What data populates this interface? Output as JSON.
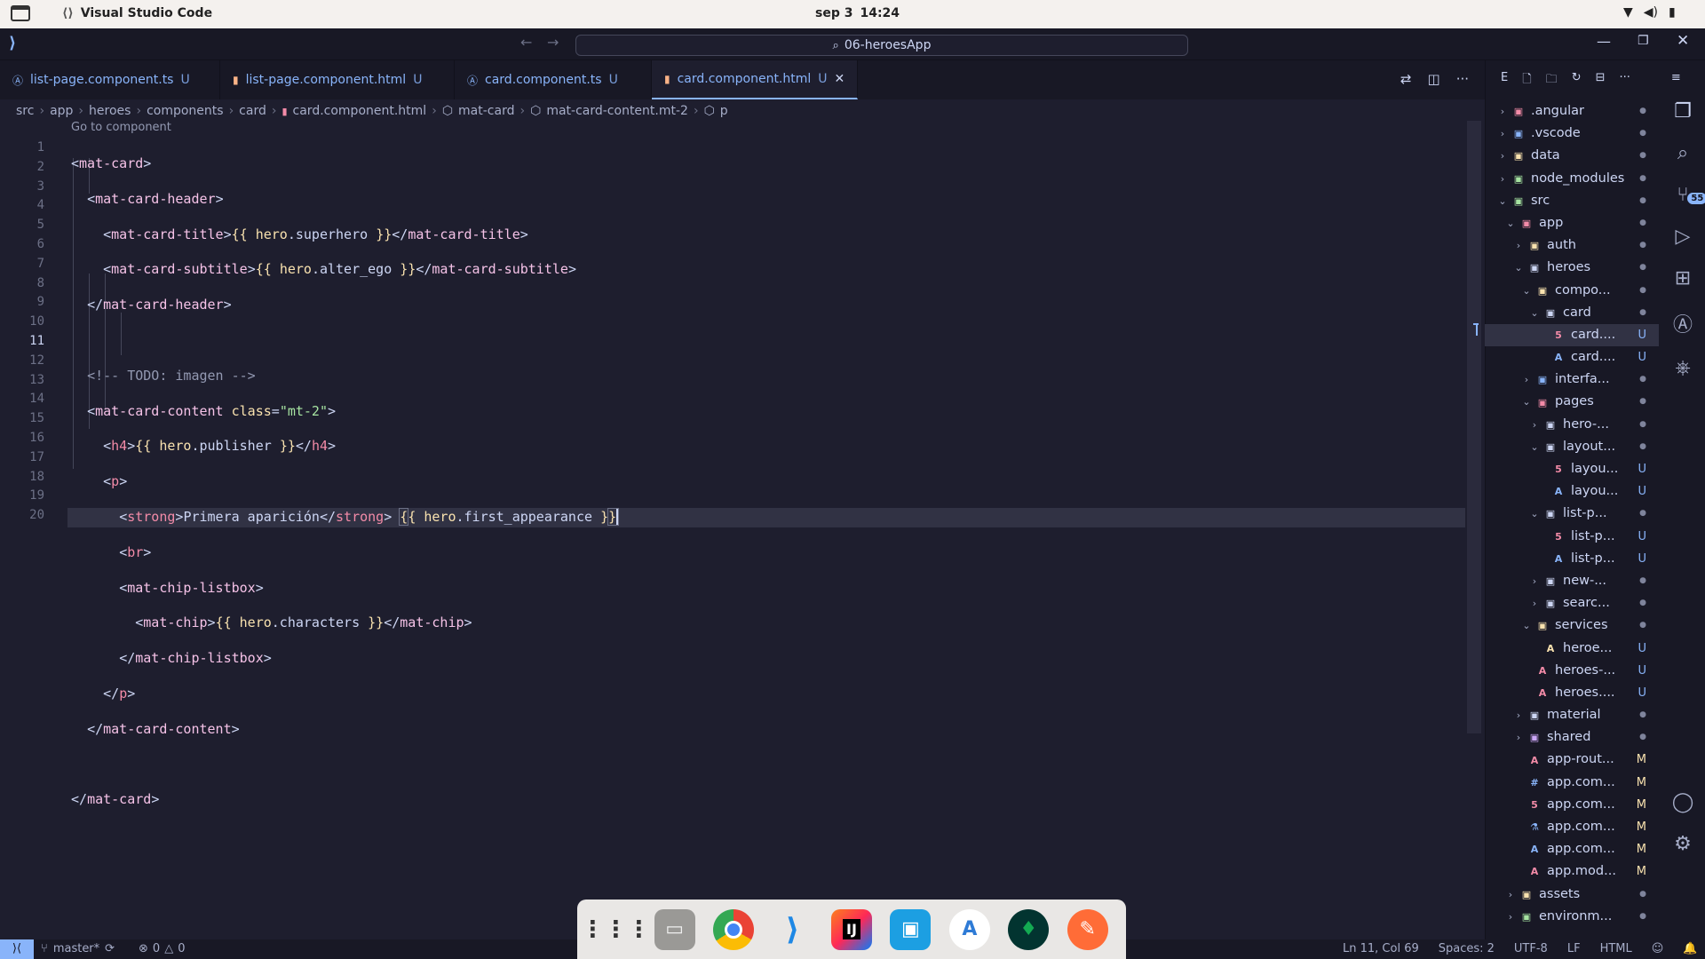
{
  "system_bar": {
    "app_name": "Visual Studio Code",
    "date": "sep 3",
    "time": "14:24"
  },
  "titlebar": {
    "search_text": "06-heroesApp"
  },
  "tabs": [
    {
      "label": "list-page.component.ts",
      "status": "U",
      "icon": "angular-ts-icon",
      "active": false
    },
    {
      "label": "list-page.component.html",
      "status": "U",
      "icon": "html-icon",
      "active": false
    },
    {
      "label": "card.component.ts",
      "status": "U",
      "icon": "angular-ts-icon",
      "active": false
    },
    {
      "label": "card.component.html",
      "status": "U",
      "icon": "html-icon",
      "active": true
    }
  ],
  "breadcrumb": {
    "items": [
      "src",
      "app",
      "heroes",
      "components",
      "card",
      "card.component.html",
      "mat-card",
      "mat-card-content.mt-2",
      "p"
    ]
  },
  "editor": {
    "codelens": "Go to component",
    "current_line": 11,
    "line_numbers": [
      "1",
      "2",
      "3",
      "4",
      "5",
      "6",
      "7",
      "8",
      "9",
      "10",
      "11",
      "12",
      "13",
      "14",
      "15",
      "16",
      "17",
      "18",
      "19",
      "20"
    ]
  },
  "explorer": {
    "header_letter": "E",
    "items": [
      {
        "label": ".angular",
        "badge": "",
        "dot": true
      },
      {
        "label": ".vscode",
        "badge": "",
        "dot": true
      },
      {
        "label": "data",
        "badge": "",
        "dot": true
      },
      {
        "label": "node_modules",
        "badge": "",
        "dot": true
      },
      {
        "label": "src",
        "badge": "",
        "dot": true
      },
      {
        "label": "app",
        "badge": "",
        "dot": true
      },
      {
        "label": "auth",
        "badge": "",
        "dot": true
      },
      {
        "label": "heroes",
        "badge": "",
        "dot": true
      },
      {
        "label": "compo...",
        "badge": "",
        "dot": true
      },
      {
        "label": "card",
        "badge": "",
        "dot": true
      },
      {
        "label": "card....",
        "badge": "U",
        "dot": false
      },
      {
        "label": "card....",
        "badge": "U",
        "dot": false
      },
      {
        "label": "interfa...",
        "badge": "",
        "dot": true
      },
      {
        "label": "pages",
        "badge": "",
        "dot": true
      },
      {
        "label": "hero-...",
        "badge": "",
        "dot": true
      },
      {
        "label": "layout...",
        "badge": "",
        "dot": true
      },
      {
        "label": "layou...",
        "badge": "U",
        "dot": false
      },
      {
        "label": "layou...",
        "badge": "U",
        "dot": false
      },
      {
        "label": "list-p...",
        "badge": "",
        "dot": true
      },
      {
        "label": "list-p...",
        "badge": "U",
        "dot": false
      },
      {
        "label": "list-p...",
        "badge": "U",
        "dot": false
      },
      {
        "label": "new-...",
        "badge": "",
        "dot": true
      },
      {
        "label": "searc...",
        "badge": "",
        "dot": true
      },
      {
        "label": "services",
        "badge": "",
        "dot": true
      },
      {
        "label": "heroe...",
        "badge": "U",
        "dot": false
      },
      {
        "label": "heroes-...",
        "badge": "U",
        "dot": false
      },
      {
        "label": "heroes....",
        "badge": "U",
        "dot": false
      },
      {
        "label": "material",
        "badge": "",
        "dot": true
      },
      {
        "label": "shared",
        "badge": "",
        "dot": true
      },
      {
        "label": "app-rout...",
        "badge": "M",
        "dot": false
      },
      {
        "label": "app.com...",
        "badge": "M",
        "dot": false
      },
      {
        "label": "app.com...",
        "badge": "M",
        "dot": false
      },
      {
        "label": "app.com...",
        "badge": "M",
        "dot": false
      },
      {
        "label": "app.com...",
        "badge": "M",
        "dot": false
      },
      {
        "label": "app.mod...",
        "badge": "M",
        "dot": false
      },
      {
        "label": "assets",
        "badge": "",
        "dot": true
      },
      {
        "label": "environm...",
        "badge": "",
        "dot": true
      }
    ]
  },
  "activity_bar": {
    "scm_badge": "55"
  },
  "statusbar": {
    "branch": "master*",
    "errors": "0",
    "warnings": "0",
    "cursor": "Ln 11, Col 69",
    "spaces": "Spaces: 2",
    "encoding": "UTF-8",
    "eol": "LF",
    "language": "HTML"
  },
  "colors": {
    "accent": "#89b4fa",
    "editor_bg": "#1e1e2e",
    "tag": "#f5c2e7",
    "expression": "#f9e2af"
  }
}
